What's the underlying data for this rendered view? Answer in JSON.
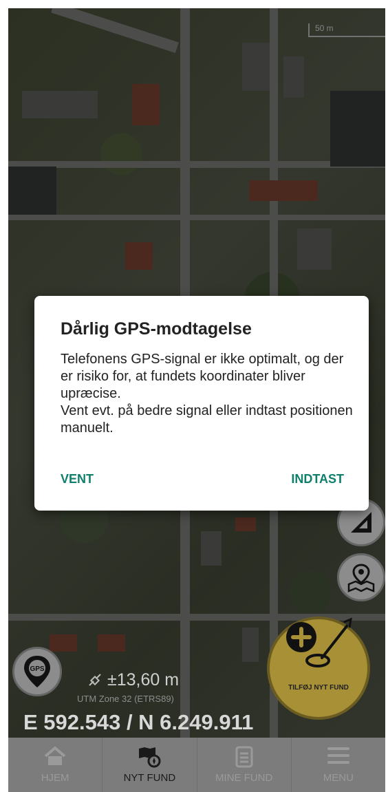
{
  "map": {
    "scale_label": "50 m"
  },
  "dialog": {
    "title": "Dårlig GPS-modtagelse",
    "body": "Telefonens GPS-signal er ikke optimalt, og der er risiko for, at fundets koordinater bliver upræcise.\nVent evt. på bedre signal eller indtast positionen manuelt.",
    "wait_label": "VENT",
    "enter_label": "INDTAST",
    "accent_color": "#0e7f6a"
  },
  "position": {
    "accuracy": "±13,60 m",
    "zone": "UTM Zone 32 (ETRS89)",
    "coordinates": "E 592.543 / N 6.249.911"
  },
  "gps_button": {
    "label": "GPS"
  },
  "add_find_button": {
    "label": "TILFØJ NYT FUND",
    "color": "#a79035"
  },
  "tabs": [
    {
      "label": "HJEM",
      "icon": "home-icon"
    },
    {
      "label": "NYT FUND",
      "icon": "map-compass-icon",
      "active": true
    },
    {
      "label": "MINE FUND",
      "icon": "document-list-icon"
    },
    {
      "label": "MENU",
      "icon": "hamburger-menu-icon"
    }
  ]
}
